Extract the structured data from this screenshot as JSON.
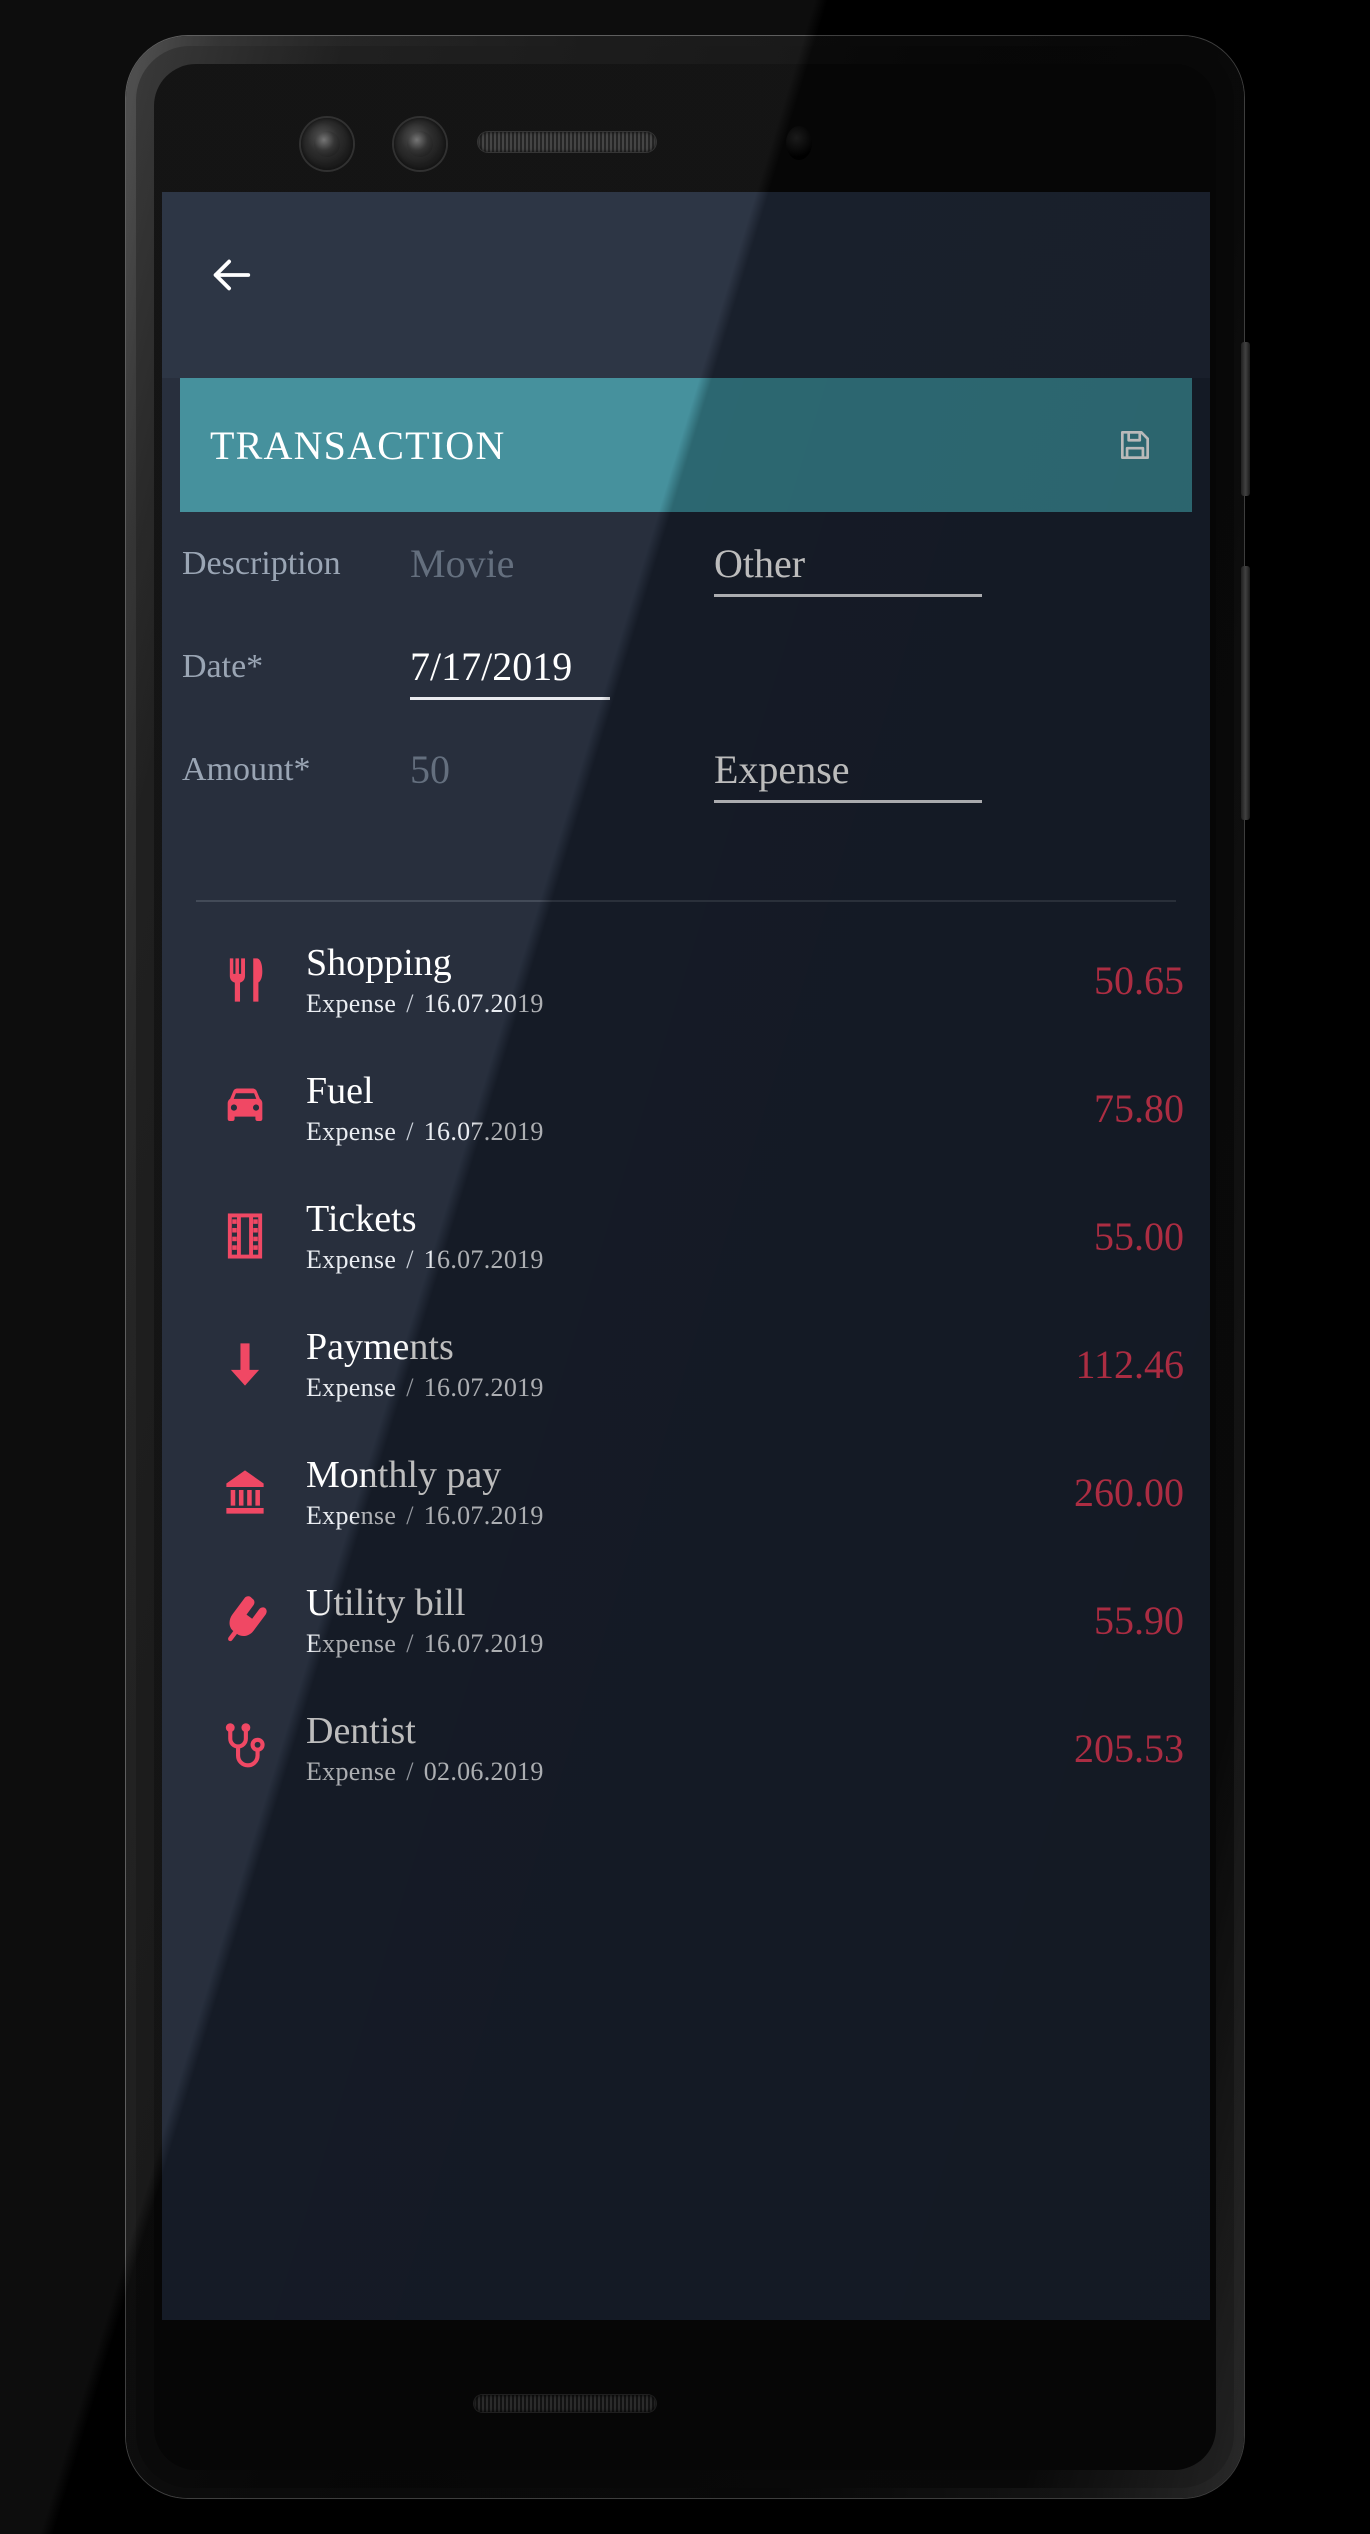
{
  "colors": {
    "screen_bg": "#1c2433",
    "topbar_bg": "#222b3b",
    "header_teal": "#3c8b98",
    "accent_red": "#ef3e5c",
    "label_grey": "#95a0b0",
    "placeholder_grey": "#5c6777",
    "text_white": "#ffffff"
  },
  "topbar": {
    "back_icon": "arrow-left-icon"
  },
  "header": {
    "title": "TRANSACTION",
    "save_icon": "floppy-save-icon"
  },
  "form": {
    "description": {
      "label": "Description",
      "value": "",
      "placeholder": "Movie"
    },
    "category": {
      "label": "",
      "value": "Other"
    },
    "date": {
      "label": "Date*",
      "value": "7/17/2019"
    },
    "amount": {
      "label": "Amount*",
      "value": "",
      "placeholder": "50"
    },
    "type": {
      "label": "",
      "value": "Expense"
    }
  },
  "transactions": [
    {
      "icon": "utensils-icon",
      "title": "Shopping",
      "type": "Expense",
      "separator": "/",
      "date": "16.07.2019",
      "amount": "50.65"
    },
    {
      "icon": "car-icon",
      "title": "Fuel",
      "type": "Expense",
      "separator": "/",
      "date": "16.07.2019",
      "amount": "75.80"
    },
    {
      "icon": "film-icon",
      "title": "Tickets",
      "type": "Expense",
      "separator": "/",
      "date": "16.07.2019",
      "amount": "55.00"
    },
    {
      "icon": "arrow-down-icon",
      "title": "Payments",
      "type": "Expense",
      "separator": "/",
      "date": "16.07.2019",
      "amount": "112.46"
    },
    {
      "icon": "bank-icon",
      "title": "Monthly pay",
      "type": "Expense",
      "separator": "/",
      "date": "16.07.2019",
      "amount": "260.00"
    },
    {
      "icon": "plug-icon",
      "title": "Utility bill",
      "type": "Expense",
      "separator": "/",
      "date": "16.07.2019",
      "amount": "55.90"
    },
    {
      "icon": "stethoscope-icon",
      "title": "Dentist",
      "type": "Expense",
      "separator": "/",
      "date": "02.06.2019",
      "amount": "205.53"
    }
  ]
}
